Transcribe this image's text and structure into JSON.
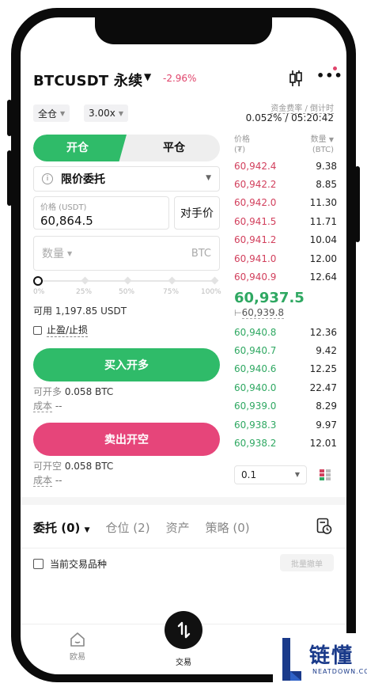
{
  "header": {
    "title": "BTCUSDT 永续",
    "change": "-2.96%"
  },
  "controls": {
    "margin_mode": "全仓",
    "leverage": "3.00x"
  },
  "funding": {
    "label": "资金费率 / 倒计时",
    "value": "0.052% / 05:20:42"
  },
  "order_form": {
    "open_label": "开仓",
    "close_label": "平仓",
    "order_type": "限价委托",
    "price_label": "价格 (USDT)",
    "price_value": "60,864.5",
    "counterparty_label": "对手价",
    "qty_placeholder": "数量",
    "qty_unit": "BTC",
    "slider_value_pct": 0,
    "slider_marks": [
      "0%",
      "25%",
      "50%",
      "75%",
      "100%"
    ],
    "available": "可用 1,197.85 USDT",
    "tpsl_label": "止盈/止损",
    "buy_label": "买入开多",
    "buy_can_open_label": "可开多",
    "buy_can_open_value": "0.058 BTC",
    "buy_cost_label": "成本",
    "buy_cost_value": "--",
    "sell_label": "卖出开空",
    "sell_can_open_label": "可开空",
    "sell_can_open_value": "0.058 BTC",
    "sell_cost_label": "成本",
    "sell_cost_value": "--"
  },
  "orderbook": {
    "price_header": "价格",
    "price_unit": "(₮)",
    "qty_header": "数量",
    "qty_unit": "(BTC)",
    "asks": [
      {
        "price": "60,942.4",
        "qty": "9.38"
      },
      {
        "price": "60,942.2",
        "qty": "8.85"
      },
      {
        "price": "60,942.0",
        "qty": "11.30"
      },
      {
        "price": "60,941.5",
        "qty": "11.71"
      },
      {
        "price": "60,941.2",
        "qty": "10.04"
      },
      {
        "price": "60,941.0",
        "qty": "12.00"
      },
      {
        "price": "60,940.9",
        "qty": "12.64"
      }
    ],
    "last_price": "60,937.5",
    "mark_prefix": "",
    "mark_price": "60,939.8",
    "bids": [
      {
        "price": "60,940.8",
        "qty": "12.36"
      },
      {
        "price": "60,940.7",
        "qty": "9.42"
      },
      {
        "price": "60,940.6",
        "qty": "12.25"
      },
      {
        "price": "60,940.0",
        "qty": "22.47"
      },
      {
        "price": "60,939.0",
        "qty": "8.29"
      },
      {
        "price": "60,938.3",
        "qty": "9.97"
      },
      {
        "price": "60,938.2",
        "qty": "12.01"
      }
    ],
    "step": "0.1"
  },
  "tabs": {
    "orders": "委托 (0)",
    "positions": "仓位 (2)",
    "assets": "资产",
    "strategies": "策略 (0)"
  },
  "filters": {
    "current_symbol": "当前交易品种",
    "batch_cancel": "批量撤单"
  },
  "bottom_nav": {
    "left": "欧易",
    "trade": "交易"
  },
  "watermark": {
    "brand": "链懂",
    "domain": "NEATDOWN.COM"
  },
  "colors": {
    "buy": "#2fbb69",
    "sell": "#e6457a",
    "ask_text": "#d2405d",
    "bid_text": "#2fa862"
  }
}
